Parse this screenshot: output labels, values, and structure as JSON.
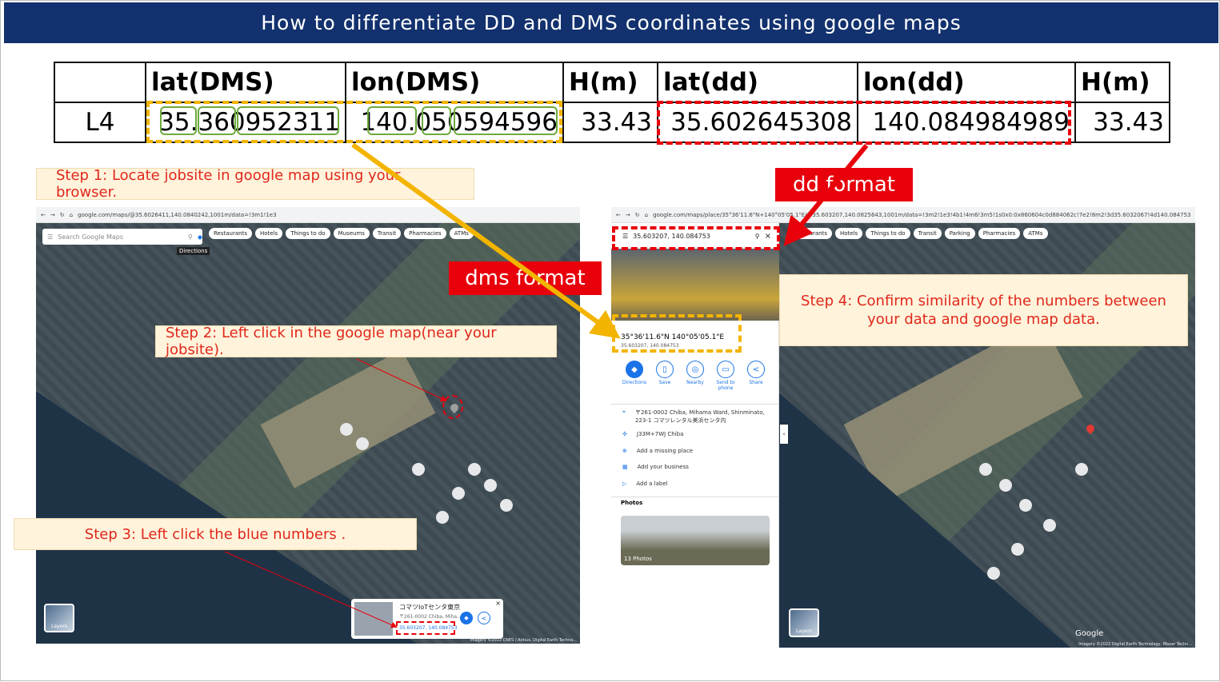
{
  "title": "How to differentiate DD and DMS coordinates using google maps",
  "table": {
    "headers": [
      "",
      "lat(DMS)",
      "lon(DMS)",
      "H(m)",
      "lat(dd)",
      "lon(dd)",
      "H(m)"
    ],
    "row": [
      "L4",
      "35.360952311",
      "140.050594596",
      "33.43",
      "35.602645308",
      "140.084984989",
      "33.43"
    ]
  },
  "labels": {
    "dd_format": "dd format",
    "dms_format": "dms format"
  },
  "steps": {
    "step1": "Step 1: Locate jobsite in google map using your browser.",
    "step2": "Step 2: Left click in the google map(near your jobsite).",
    "step3": "Step 3: Left click the blue numbers .",
    "step4": "Step 4: Confirm similarity of the numbers between your data and google map data."
  },
  "left_screenshot": {
    "url": "google.com/maps/@35.6026411,140.0840242,1001m/data=!3m1!1e3",
    "search_placeholder": "Search Google Maps",
    "directions_tooltip": "Directions",
    "chips": [
      "Restaurants",
      "Hotels",
      "Things to do",
      "Museums",
      "Transit",
      "Pharmacies",
      "ATMs"
    ],
    "card_title": "コマツIoTセンタ東京",
    "card_address": "〒261-0002 Chiba, Miha...",
    "card_coords": "35.603207, 140.084753",
    "layers_label": "Layers",
    "credit": "Imagery ©2022 CNES / Airbus, Digital Earth Techno..."
  },
  "right_screenshot": {
    "url": "google.com/maps/place/35°36'11.6\"N+140°05'05.1\"E/@35.603207,140.0825643,1001m/data=!3m2!1e3!4b1!4m6!3m5!1s0x0:0x860604c0d884062c!7e2!8m2!3d35.6032067!4d140.084753",
    "search_value": "35.603207, 140.084753",
    "chips": [
      "Restaurants",
      "Hotels",
      "Things to do",
      "Transit",
      "Parking",
      "Pharmacies",
      "ATMs"
    ],
    "dms_text": "35°36'11.6\"N 140°05'05.1\"E",
    "dd_text": "35.603207, 140.084753",
    "actions": [
      "Directions",
      "Save",
      "Nearby",
      "Send to phone",
      "Share"
    ],
    "place_rows": [
      {
        "icon": "pin-icon",
        "text": "〒261-0002 Chiba, Mihama Ward, Shinminato, 223-1 コマツレンタル美浜センタ内"
      },
      {
        "icon": "plus-code-icon",
        "text": "J33M+7WJ Chiba"
      },
      {
        "icon": "add-place-icon",
        "text": "Add a missing place"
      },
      {
        "icon": "business-icon",
        "text": "Add your business"
      },
      {
        "icon": "label-icon",
        "text": "Add a label"
      }
    ],
    "photos_heading": "Photos",
    "photos_count": "13 Photos",
    "layers_label": "Layers",
    "google_logo": "Google",
    "credit": "Imagery ©2022 Digital Earth Technology, Maxar Techn..."
  },
  "colors": {
    "title_bg": "#12316e",
    "callout_bg": "#fff3dc",
    "callout_text": "#e0281b",
    "dashed_orange": "#f3b400",
    "dashed_red": "#e8000b",
    "green_box": "#6cab3b"
  }
}
